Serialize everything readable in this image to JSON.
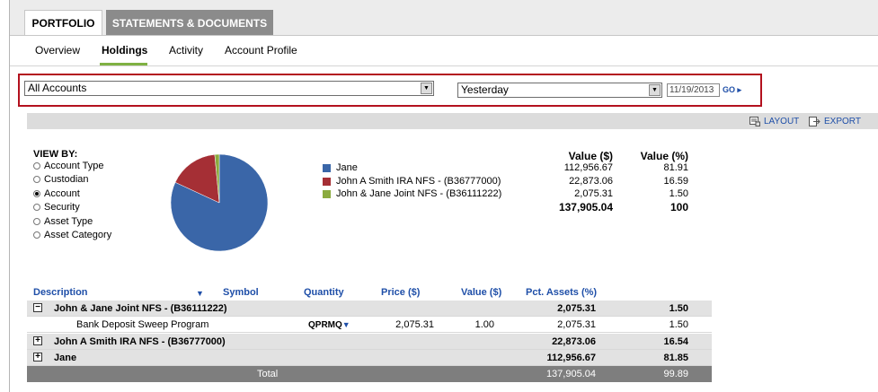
{
  "tabs": [
    {
      "label": "PORTFOLIO",
      "active": true
    },
    {
      "label": "STATEMENTS & DOCUMENTS",
      "active": false
    }
  ],
  "subnav": [
    {
      "label": "Overview",
      "active": false
    },
    {
      "label": "Holdings",
      "active": true
    },
    {
      "label": "Activity",
      "active": false
    },
    {
      "label": "Account Profile",
      "active": false
    }
  ],
  "filters": {
    "account_select": "All Accounts",
    "period_select": "Yesterday",
    "date_value": "11/19/2013",
    "go_label": "GO"
  },
  "toolbar": {
    "layout_label": "LAYOUT",
    "export_label": "EXPORT"
  },
  "view_by": {
    "title": "VIEW BY:",
    "options": [
      {
        "label": "Account Type",
        "checked": false
      },
      {
        "label": "Custodian",
        "checked": false
      },
      {
        "label": "Account",
        "checked": true
      },
      {
        "label": "Security",
        "checked": false
      },
      {
        "label": "Asset Type",
        "checked": false
      },
      {
        "label": "Asset Category",
        "checked": false
      }
    ]
  },
  "allocation": {
    "value_header": "Value ($)",
    "pct_header": "Value (%)",
    "rows": [
      {
        "name": "Jane",
        "color": "#3a66a8",
        "value": "112,956.67",
        "pct": "81.91",
        "share": 81.91
      },
      {
        "name": "John A Smith IRA NFS - (B36777000)",
        "color": "#a52f35",
        "value": "22,873.06",
        "pct": "16.59",
        "share": 16.59
      },
      {
        "name": "John & Jane Joint NFS - (B36111222)",
        "color": "#8bab3f",
        "value": "2,075.31",
        "pct": "1.50",
        "share": 1.5
      }
    ],
    "total_value": "137,905.04",
    "total_pct": "100"
  },
  "holdings": {
    "headers": {
      "description": "Description",
      "symbol": "Symbol",
      "quantity": "Quantity",
      "price": "Price ($)",
      "value": "Value ($)",
      "pct_assets": "Pct. Assets (%)"
    },
    "group1": {
      "name": "John & Jane Joint NFS - (B36111222)",
      "value": "2,075.31",
      "pct": "1.50",
      "expander": "−"
    },
    "detail1": {
      "name": "Bank Deposit Sweep Program",
      "symbol": "QPRMQ",
      "quantity": "2,075.31",
      "price": "1.00",
      "value": "2,075.31",
      "pct": "1.50"
    },
    "group2": {
      "name": "John A Smith IRA NFS - (B36777000)",
      "value": "22,873.06",
      "pct": "16.54",
      "expander": "+"
    },
    "group3": {
      "name": "Jane",
      "value": "112,956.67",
      "pct": "81.85",
      "expander": "+"
    },
    "total": {
      "label": "Total",
      "value": "137,905.04",
      "pct": "99.89"
    }
  }
}
